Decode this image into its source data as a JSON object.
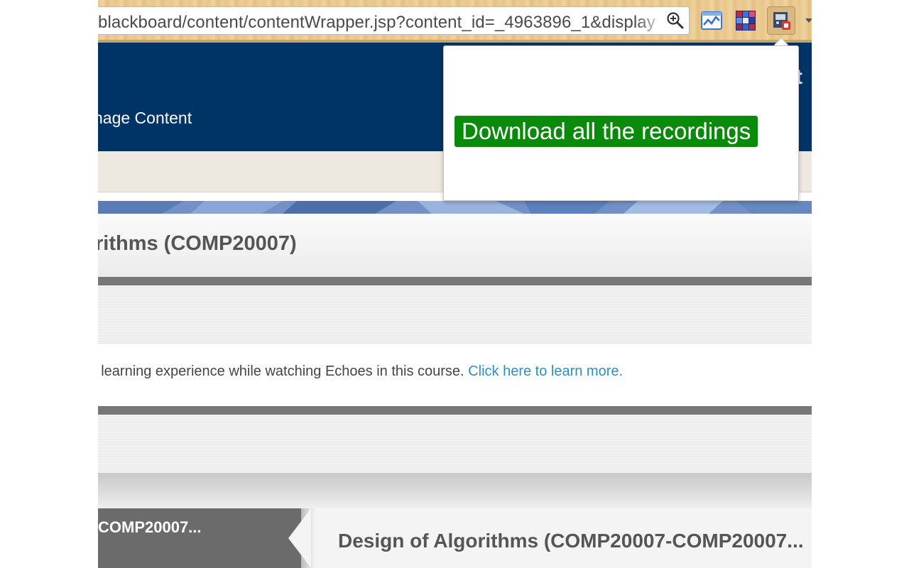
{
  "browser": {
    "url": "blackboard/content/contentWrapper.jsp?content_id=_4963896_1&display",
    "zoom_icon": "magnifier-plus-icon",
    "extensions": [
      {
        "name": "chart-extension-icon"
      },
      {
        "name": "mosaic-extension-icon"
      },
      {
        "name": "echo-downloader-extension-icon"
      }
    ]
  },
  "popup": {
    "download_button_label": "Download all the recordings",
    "button_color": "#0a8a0a"
  },
  "header": {
    "manage_content": "nage Content",
    "right_glimpse": "t",
    "color": "#003366"
  },
  "course": {
    "title": "rithms (COMP20007)",
    "notice_text": "r learning experience while watching Echoes in this course.",
    "notice_link": "Click here to learn more.",
    "tab_label": "COMP20007...",
    "content_title": "Design of Algorithms (COMP20007-COMP20007..."
  },
  "colors": {
    "link": "#2e8ec4",
    "rule": "#777777"
  }
}
